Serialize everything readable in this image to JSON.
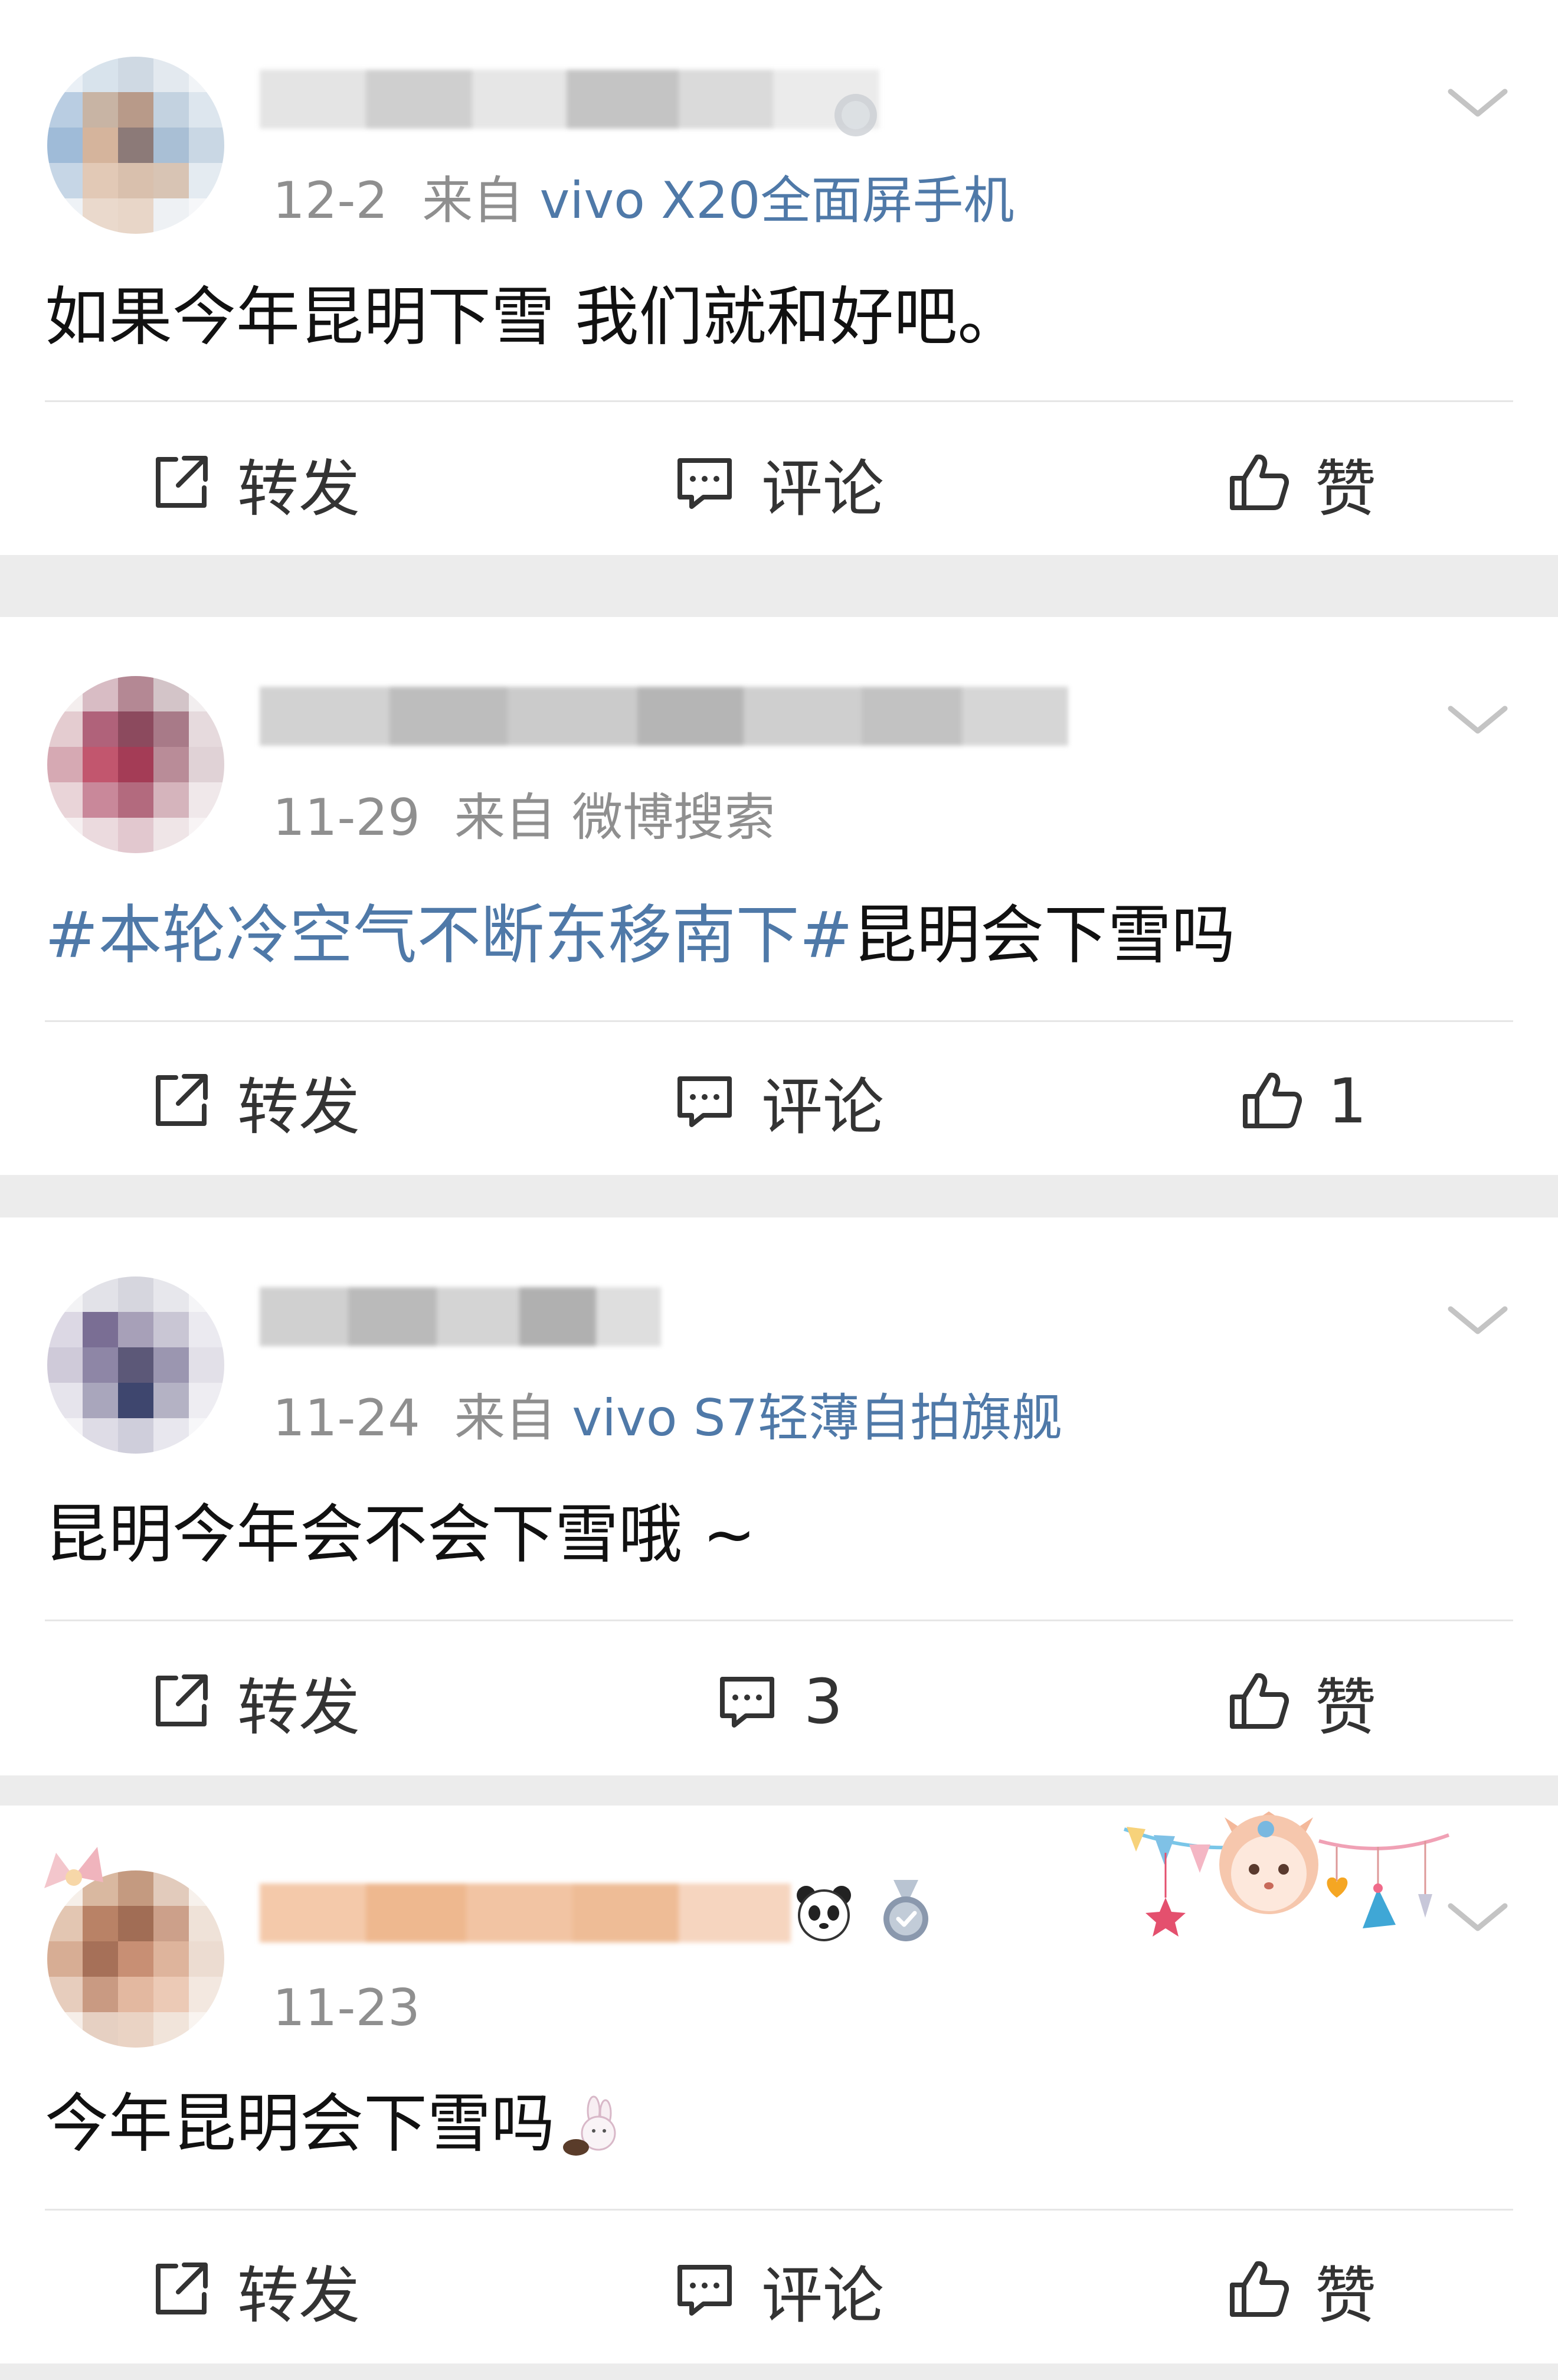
{
  "labels": {
    "repost": "转发",
    "comment": "评论",
    "like": "赞"
  },
  "icons": {
    "repost": "share-box-icon",
    "comment": "comment-bubble-icon",
    "like": "thumbs-up-icon",
    "more": "chevron-down-icon"
  },
  "colors": {
    "link_blue": "#4f79a8",
    "meta_gray": "#8f8f8f",
    "separator": "#ececec"
  },
  "posts": [
    {
      "date": "12-2",
      "from_prefix": "来自",
      "source": "vivo X20全面屏手机",
      "text": "如果今年昆明下雪 我们就和好吧。",
      "repost_label": "转发",
      "comment_label": "评论",
      "like_label": "赞"
    },
    {
      "date": "11-29",
      "from_prefix": "来自",
      "source": "微博搜索",
      "topic": "#本轮冷空气不断东移南下#",
      "text": "昆明会下雪吗",
      "repost_label": "转发",
      "comment_label": "评论",
      "like_count": "1"
    },
    {
      "date": "11-24",
      "from_prefix": "来自",
      "source": "vivo S7轻薄自拍旗舰",
      "text": "昆明今年会不会下雪哦 ~",
      "repost_label": "转发",
      "comment_count": "3",
      "like_label": "赞"
    },
    {
      "date": "11-23",
      "text": "今年昆明会下雪吗",
      "repost_label": "转发",
      "comment_label": "评论",
      "like_label": "赞"
    }
  ]
}
